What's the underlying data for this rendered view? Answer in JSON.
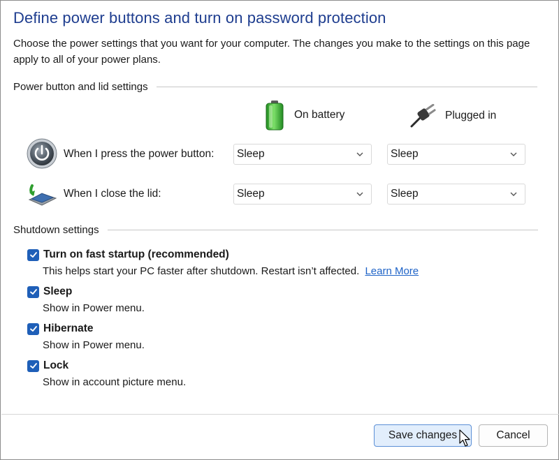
{
  "window": {
    "title": "Define power buttons and turn on password protection",
    "intro": "Choose the power settings that you want for your computer. The changes you make to the settings on this page apply to all of your power plans."
  },
  "power_section": {
    "header": "Power button and lid settings",
    "columns": {
      "battery": {
        "label": "On battery",
        "icon": "battery-icon"
      },
      "plugged": {
        "label": "Plugged in",
        "icon": "plug-icon"
      }
    },
    "rows": [
      {
        "label": "When I press the power button:",
        "icon": "power-button-icon",
        "battery_value": "Sleep",
        "plugged_value": "Sleep"
      },
      {
        "label": "When I close the lid:",
        "icon": "laptop-lid-icon",
        "battery_value": "Sleep",
        "plugged_value": "Sleep"
      }
    ]
  },
  "shutdown_section": {
    "header": "Shutdown settings",
    "items": [
      {
        "title": "Turn on fast startup (recommended)",
        "description": "This helps start your PC faster after shutdown. Restart isn’t affected.",
        "link": "Learn More",
        "checked": true
      },
      {
        "title": "Sleep",
        "description": "Show in Power menu.",
        "checked": true
      },
      {
        "title": "Hibernate",
        "description": "Show in Power menu.",
        "checked": true
      },
      {
        "title": "Lock",
        "description": "Show in account picture menu.",
        "checked": true
      }
    ]
  },
  "footer": {
    "save_label": "Save changes",
    "cancel_label": "Cancel"
  },
  "colors": {
    "title": "#1e3d8f",
    "checkbox": "#1f5fb8",
    "link": "#1e63c7",
    "primary_button_bg": "#e2eefc"
  }
}
